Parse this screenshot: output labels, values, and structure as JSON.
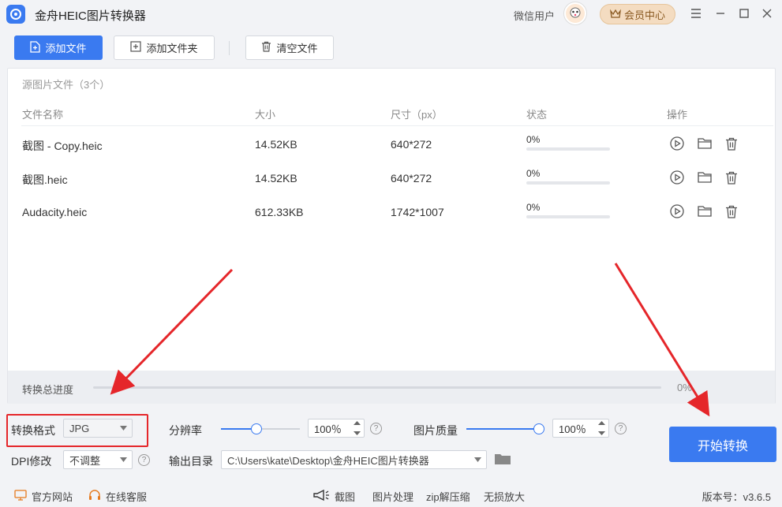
{
  "app": {
    "title": "金舟HEIC图片转换器",
    "user_name": "微信用户",
    "vip_label": "会员中心",
    "window_controls": [
      "menu-icon",
      "minimize-icon",
      "maximize-icon",
      "close-icon"
    ]
  },
  "toolbar": {
    "add_file_label": "添加文件",
    "add_folder_label": "添加文件夹",
    "clear_label": "清空文件"
  },
  "file_panel": {
    "title": "源图片文件（3个）",
    "columns": [
      "文件名称",
      "大小",
      "尺寸（px）",
      "状态",
      "操作"
    ],
    "rows": [
      {
        "name": "截图 - Copy.heic",
        "size": "14.52KB",
        "dimensions": "640*272",
        "status": "0%",
        "progress": 0
      },
      {
        "name": "截图.heic",
        "size": "14.52KB",
        "dimensions": "640*272",
        "status": "0%",
        "progress": 0
      },
      {
        "name": "Audacity.heic",
        "size": "612.33KB",
        "dimensions": "1742*1007",
        "status": "0%",
        "progress": 0
      }
    ],
    "row_actions": [
      "play-icon",
      "folder-icon",
      "trash-icon"
    ],
    "total_progress_label": "转换总进度",
    "total_progress_value": "0%",
    "total_progress": 0
  },
  "settings": {
    "format_label": "转换格式",
    "format_value": "JPG",
    "resolution_label": "分辨率",
    "resolution_value": "100％",
    "resolution_level": 0.45,
    "quality_label": "图片质量",
    "quality_value": "100％",
    "quality_level": 1.0,
    "dpi_label": "DPI修改",
    "dpi_value": "不调整",
    "output_label": "输出目录",
    "output_path": "C:\\Users\\kate\\Desktop\\金舟HEIC图片转换器",
    "help_glyph": "?",
    "start_label": "开始转换"
  },
  "footer": {
    "website_label": "官方网站",
    "service_label": "在线客服",
    "tools": [
      "截图",
      "图片处理",
      "zip解压缩",
      "无损放大"
    ],
    "version_label": "版本号：v3.6.5"
  },
  "colors": {
    "accent": "#3a7af0",
    "highlight_red": "#e5262a",
    "vip_bg": "#f4dcc1"
  }
}
